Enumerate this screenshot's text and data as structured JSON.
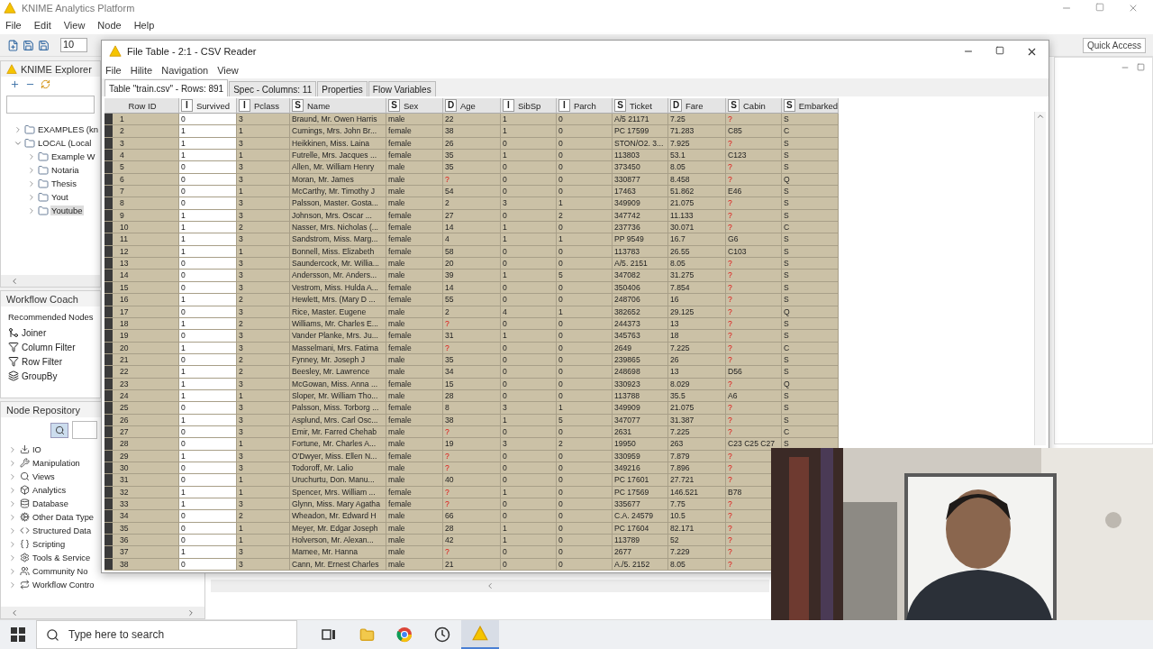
{
  "app": {
    "title": "KNIME Analytics Platform",
    "menu": [
      "File",
      "Edit",
      "View",
      "Node",
      "Help"
    ],
    "zoom_value": "10",
    "quick_access": "Quick Access"
  },
  "explorer": {
    "title": "KNIME Explorer",
    "tree": [
      {
        "label": "EXAMPLES (kn",
        "expanded": false,
        "selected": false
      },
      {
        "label": "LOCAL (Local",
        "expanded": true,
        "selected": false,
        "children": [
          {
            "label": "Example W",
            "expanded": false,
            "selected": false
          },
          {
            "label": "Notaria",
            "expanded": false,
            "selected": false
          },
          {
            "label": "Thesis",
            "expanded": false,
            "selected": false
          },
          {
            "label": "Yout",
            "expanded": false,
            "selected": false
          },
          {
            "label": "Youtube",
            "expanded": false,
            "selected": true
          }
        ]
      }
    ]
  },
  "workflow_coach": {
    "title": "Workflow Coach",
    "heading": "Recommended Nodes",
    "nodes": [
      "Joiner",
      "Column Filter",
      "Row Filter",
      "GroupBy"
    ]
  },
  "node_repository": {
    "title": "Node Repository",
    "categories": [
      "IO",
      "Manipulation",
      "Views",
      "Analytics",
      "Database",
      "Other Data Type",
      "Structured Data",
      "Scripting",
      "Tools & Service",
      "Community No",
      "Workflow Contro"
    ]
  },
  "dialog": {
    "title": "File Table - 2:1 - CSV Reader",
    "menu": [
      "File",
      "Hilite",
      "Navigation",
      "View"
    ],
    "tabs": [
      {
        "label": "Table \"train.csv\" - Rows: 891",
        "selected": true
      },
      {
        "label": "Spec - Columns: 11",
        "selected": false
      },
      {
        "label": "Properties",
        "selected": false
      },
      {
        "label": "Flow Variables",
        "selected": false
      }
    ],
    "table": {
      "columns": [
        {
          "name": "Row ID",
          "selected": false
        },
        {
          "type": "I",
          "name": "Survived",
          "selected": true
        },
        {
          "type": "I",
          "name": "Pclass",
          "selected": false
        },
        {
          "type": "S",
          "name": "Name",
          "selected": false
        },
        {
          "type": "S",
          "name": "Sex",
          "selected": false
        },
        {
          "type": "D",
          "name": "Age",
          "selected": false
        },
        {
          "type": "I",
          "name": "SibSp",
          "selected": false
        },
        {
          "type": "I",
          "name": "Parch",
          "selected": false
        },
        {
          "type": "S",
          "name": "Ticket",
          "selected": false
        },
        {
          "type": "D",
          "name": "Fare",
          "selected": false
        },
        {
          "type": "S",
          "name": "Cabin",
          "selected": false
        },
        {
          "type": "S",
          "name": "Embarked",
          "selected": false
        }
      ],
      "rows": [
        {
          "cells": [
            "1",
            "0",
            "3",
            "Braund, Mr. Owen Harris",
            "male",
            "22",
            "1",
            "0",
            "A/5 21171",
            "7.25",
            {
              "text": "?",
              "missing": true
            },
            "S"
          ]
        },
        {
          "cells": [
            "2",
            "1",
            "1",
            "Cumings, Mrs. John Br...",
            "female",
            "38",
            "1",
            "0",
            "PC 17599",
            "71.283",
            "C85",
            "C"
          ]
        },
        {
          "cells": [
            "3",
            "1",
            "3",
            "Heikkinen, Miss. Laina",
            "female",
            "26",
            "0",
            "0",
            "STON/O2. 3...",
            "7.925",
            {
              "text": "?",
              "missing": true
            },
            "S"
          ]
        },
        {
          "cells": [
            "4",
            "1",
            "1",
            "Futrelle, Mrs. Jacques ...",
            "female",
            "35",
            "1",
            "0",
            "113803",
            "53.1",
            "C123",
            "S"
          ]
        },
        {
          "cells": [
            "5",
            "0",
            "3",
            "Allen, Mr. William Henry",
            "male",
            "35",
            "0",
            "0",
            "373450",
            "8.05",
            {
              "text": "?",
              "missing": true
            },
            "S"
          ]
        },
        {
          "cells": [
            "6",
            "0",
            "3",
            "Moran, Mr. James",
            "male",
            {
              "text": "?",
              "missing": true
            },
            "0",
            "0",
            "330877",
            "8.458",
            {
              "text": "?",
              "missing": true
            },
            "Q"
          ]
        },
        {
          "cells": [
            "7",
            "0",
            "1",
            "McCarthy, Mr. Timothy J",
            "male",
            "54",
            "0",
            "0",
            "17463",
            "51.862",
            "E46",
            "S"
          ]
        },
        {
          "cells": [
            "8",
            "0",
            "3",
            "Palsson, Master. Gosta...",
            "male",
            "2",
            "3",
            "1",
            "349909",
            "21.075",
            {
              "text": "?",
              "missing": true
            },
            "S"
          ]
        },
        {
          "cells": [
            "9",
            "1",
            "3",
            "Johnson, Mrs. Oscar ...",
            "female",
            "27",
            "0",
            "2",
            "347742",
            "11.133",
            {
              "text": "?",
              "missing": true
            },
            "S"
          ]
        },
        {
          "cells": [
            "10",
            "1",
            "2",
            "Nasser, Mrs. Nicholas (...",
            "female",
            "14",
            "1",
            "0",
            "237736",
            "30.071",
            {
              "text": "?",
              "missing": true
            },
            "C"
          ]
        },
        {
          "cells": [
            "11",
            "1",
            "3",
            "Sandstrom, Miss. Marg...",
            "female",
            "4",
            "1",
            "1",
            "PP 9549",
            "16.7",
            "G6",
            "S"
          ]
        },
        {
          "cells": [
            "12",
            "1",
            "1",
            "Bonnell, Miss. Elizabeth",
            "female",
            "58",
            "0",
            "0",
            "113783",
            "26.55",
            "C103",
            "S"
          ]
        },
        {
          "cells": [
            "13",
            "0",
            "3",
            "Saundercock, Mr. Willia...",
            "male",
            "20",
            "0",
            "0",
            "A/5. 2151",
            "8.05",
            {
              "text": "?",
              "missing": true
            },
            "S"
          ]
        },
        {
          "cells": [
            "14",
            "0",
            "3",
            "Andersson, Mr. Anders...",
            "male",
            "39",
            "1",
            "5",
            "347082",
            "31.275",
            {
              "text": "?",
              "missing": true
            },
            "S"
          ]
        },
        {
          "cells": [
            "15",
            "0",
            "3",
            "Vestrom, Miss. Hulda A...",
            "female",
            "14",
            "0",
            "0",
            "350406",
            "7.854",
            {
              "text": "?",
              "missing": true
            },
            "S"
          ]
        },
        {
          "cells": [
            "16",
            "1",
            "2",
            "Hewlett, Mrs. (Mary D ...",
            "female",
            "55",
            "0",
            "0",
            "248706",
            "16",
            {
              "text": "?",
              "missing": true
            },
            "S"
          ]
        },
        {
          "cells": [
            "17",
            "0",
            "3",
            "Rice, Master. Eugene",
            "male",
            "2",
            "4",
            "1",
            "382652",
            "29.125",
            {
              "text": "?",
              "missing": true
            },
            "Q"
          ]
        },
        {
          "cells": [
            "18",
            "1",
            "2",
            "Williams, Mr. Charles E...",
            "male",
            {
              "text": "?",
              "missing": true
            },
            "0",
            "0",
            "244373",
            "13",
            {
              "text": "?",
              "missing": true
            },
            "S"
          ]
        },
        {
          "cells": [
            "19",
            "0",
            "3",
            "Vander Planke, Mrs. Ju...",
            "female",
            "31",
            "1",
            "0",
            "345763",
            "18",
            {
              "text": "?",
              "missing": true
            },
            "S"
          ]
        },
        {
          "cells": [
            "20",
            "1",
            "3",
            "Masselmani, Mrs. Fatima",
            "female",
            {
              "text": "?",
              "missing": true
            },
            "0",
            "0",
            "2649",
            "7.225",
            {
              "text": "?",
              "missing": true
            },
            "C"
          ]
        },
        {
          "cells": [
            "21",
            "0",
            "2",
            "Fynney, Mr. Joseph J",
            "male",
            "35",
            "0",
            "0",
            "239865",
            "26",
            {
              "text": "?",
              "missing": true
            },
            "S"
          ]
        },
        {
          "cells": [
            "22",
            "1",
            "2",
            "Beesley, Mr. Lawrence",
            "male",
            "34",
            "0",
            "0",
            "248698",
            "13",
            "D56",
            "S"
          ]
        },
        {
          "cells": [
            "23",
            "1",
            "3",
            "McGowan, Miss. Anna ...",
            "female",
            "15",
            "0",
            "0",
            "330923",
            "8.029",
            {
              "text": "?",
              "missing": true
            },
            "Q"
          ]
        },
        {
          "cells": [
            "24",
            "1",
            "1",
            "Sloper, Mr. William Tho...",
            "male",
            "28",
            "0",
            "0",
            "113788",
            "35.5",
            "A6",
            "S"
          ]
        },
        {
          "cells": [
            "25",
            "0",
            "3",
            "Palsson, Miss. Torborg ...",
            "female",
            "8",
            "3",
            "1",
            "349909",
            "21.075",
            {
              "text": "?",
              "missing": true
            },
            "S"
          ]
        },
        {
          "cells": [
            "26",
            "1",
            "3",
            "Asplund, Mrs. Carl Osc...",
            "female",
            "38",
            "1",
            "5",
            "347077",
            "31.387",
            {
              "text": "?",
              "missing": true
            },
            "S"
          ]
        },
        {
          "cells": [
            "27",
            "0",
            "3",
            "Emir, Mr. Farred Chehab",
            "male",
            {
              "text": "?",
              "missing": true
            },
            "0",
            "0",
            "2631",
            "7.225",
            {
              "text": "?",
              "missing": true
            },
            "C"
          ]
        },
        {
          "cells": [
            "28",
            "0",
            "1",
            "Fortune, Mr. Charles A...",
            "male",
            "19",
            "3",
            "2",
            "19950",
            "263",
            "C23 C25 C27",
            "S"
          ]
        },
        {
          "cells": [
            "29",
            "1",
            "3",
            "O'Dwyer, Miss. Ellen N...",
            "female",
            {
              "text": "?",
              "missing": true
            },
            "0",
            "0",
            "330959",
            "7.879",
            {
              "text": "?",
              "missing": true
            }
          ]
        },
        {
          "cells": [
            "30",
            "0",
            "3",
            "Todoroff, Mr. Lalio",
            "male",
            {
              "text": "?",
              "missing": true
            },
            "0",
            "0",
            "349216",
            "7.896",
            {
              "text": "?",
              "missing": true
            }
          ]
        },
        {
          "cells": [
            "31",
            "0",
            "1",
            "Uruchurtu, Don. Manu...",
            "male",
            "40",
            "0",
            "0",
            "PC 17601",
            "27.721",
            {
              "text": "?",
              "missing": true
            }
          ]
        },
        {
          "cells": [
            "32",
            "1",
            "1",
            "Spencer, Mrs. William ...",
            "female",
            {
              "text": "?",
              "missing": true
            },
            "1",
            "0",
            "PC 17569",
            "146.521",
            "B78"
          ]
        },
        {
          "cells": [
            "33",
            "1",
            "3",
            "Glynn, Miss. Mary Agatha",
            "female",
            {
              "text": "?",
              "missing": true
            },
            "0",
            "0",
            "335677",
            "7.75",
            {
              "text": "?",
              "missing": true
            }
          ]
        },
        {
          "cells": [
            "34",
            "0",
            "2",
            "Wheadon, Mr. Edward H",
            "male",
            "66",
            "0",
            "0",
            "C.A. 24579",
            "10.5",
            {
              "text": "?",
              "missing": true
            }
          ]
        },
        {
          "cells": [
            "35",
            "0",
            "1",
            "Meyer, Mr. Edgar Joseph",
            "male",
            "28",
            "1",
            "0",
            "PC 17604",
            "82.171",
            {
              "text": "?",
              "missing": true
            }
          ]
        },
        {
          "cells": [
            "36",
            "0",
            "1",
            "Holverson, Mr. Alexan...",
            "male",
            "42",
            "1",
            "0",
            "113789",
            "52",
            {
              "text": "?",
              "missing": true
            }
          ]
        },
        {
          "cells": [
            "37",
            "1",
            "3",
            "Mamee, Mr. Hanna",
            "male",
            {
              "text": "?",
              "missing": true
            },
            "0",
            "0",
            "2677",
            "7.229",
            {
              "text": "?",
              "missing": true
            }
          ]
        },
        {
          "cells": [
            "38",
            "0",
            "3",
            "Cann, Mr. Ernest Charles",
            "male",
            "21",
            "0",
            "0",
            "A./5. 2152",
            "8.05",
            {
              "text": "?",
              "missing": true
            }
          ]
        }
      ]
    }
  },
  "taskbar": {
    "search_placeholder": "Type here to search"
  }
}
